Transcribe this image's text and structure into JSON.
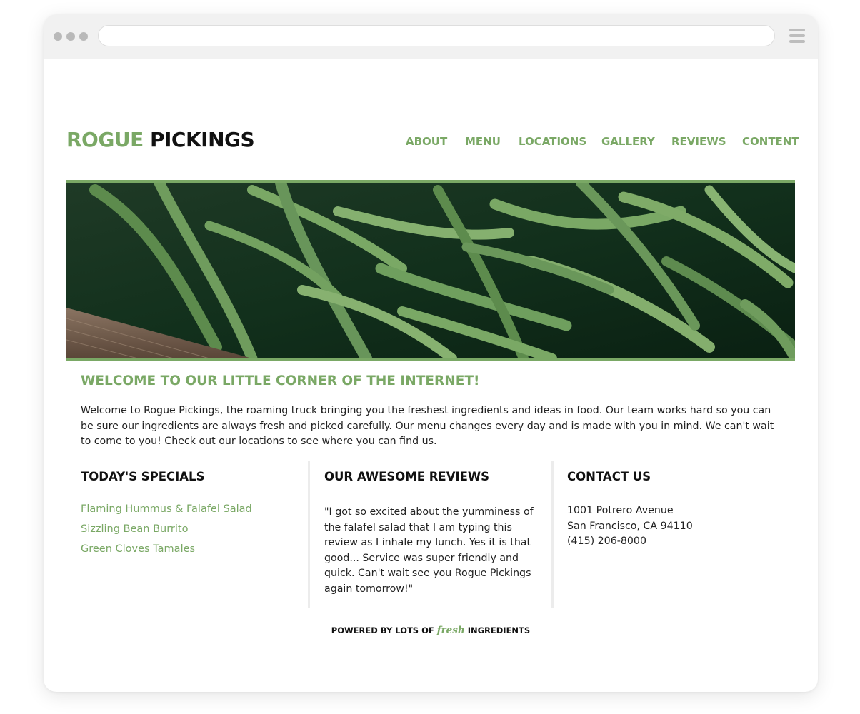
{
  "browser": {
    "url": "",
    "menu_icon": "hamburger-icon"
  },
  "site": {
    "logo_part1": "ROGUE",
    "logo_part2": "PICKINGS",
    "brand_color": "#7aa865"
  },
  "nav": [
    {
      "label": "ABOUT"
    },
    {
      "label": "MENU"
    },
    {
      "label": "LOCATIONS"
    },
    {
      "label": "GALLERY"
    },
    {
      "label": "REVIEWS"
    },
    {
      "label": "CONTENT"
    }
  ],
  "hero": {
    "image": "green-beans-photo"
  },
  "welcome": {
    "title": "WELCOME TO OUR LITTLE CORNER OF THE INTERNET!",
    "text": "Welcome to Rogue Pickings, the roaming truck bringing you the freshest ingredients and ideas in food. Our team works hard so you can be sure our ingredients are always fresh and picked carefully. Our menu changes every day and is made with you in mind. We can't wait to come to you! Check out our locations to see where you can find us."
  },
  "specials": {
    "title": "TODAY'S SPECIALS",
    "items": [
      "Flaming Hummus & Falafel Salad",
      "Sizzling Bean Burrito",
      "Green Cloves Tamales"
    ]
  },
  "reviews": {
    "title": "OUR AWESOME REVIEWS",
    "text": "\"I got so excited about the yumminess of the falafel salad that I am typing this review as I inhale my lunch. Yes it is that good... Service was super friendly and quick. Can't wait see you Rogue Pickings again tomorrow!\""
  },
  "contact": {
    "title": "CONTACT US",
    "address_line1": "1001 Potrero Avenue",
    "address_line2": "San Francisco, CA 94110",
    "phone": "(415) 206-8000"
  },
  "footer": {
    "prefix": "POWERED BY LOTS OF",
    "fresh_word": "fresh",
    "suffix": "INGREDIENTS"
  }
}
